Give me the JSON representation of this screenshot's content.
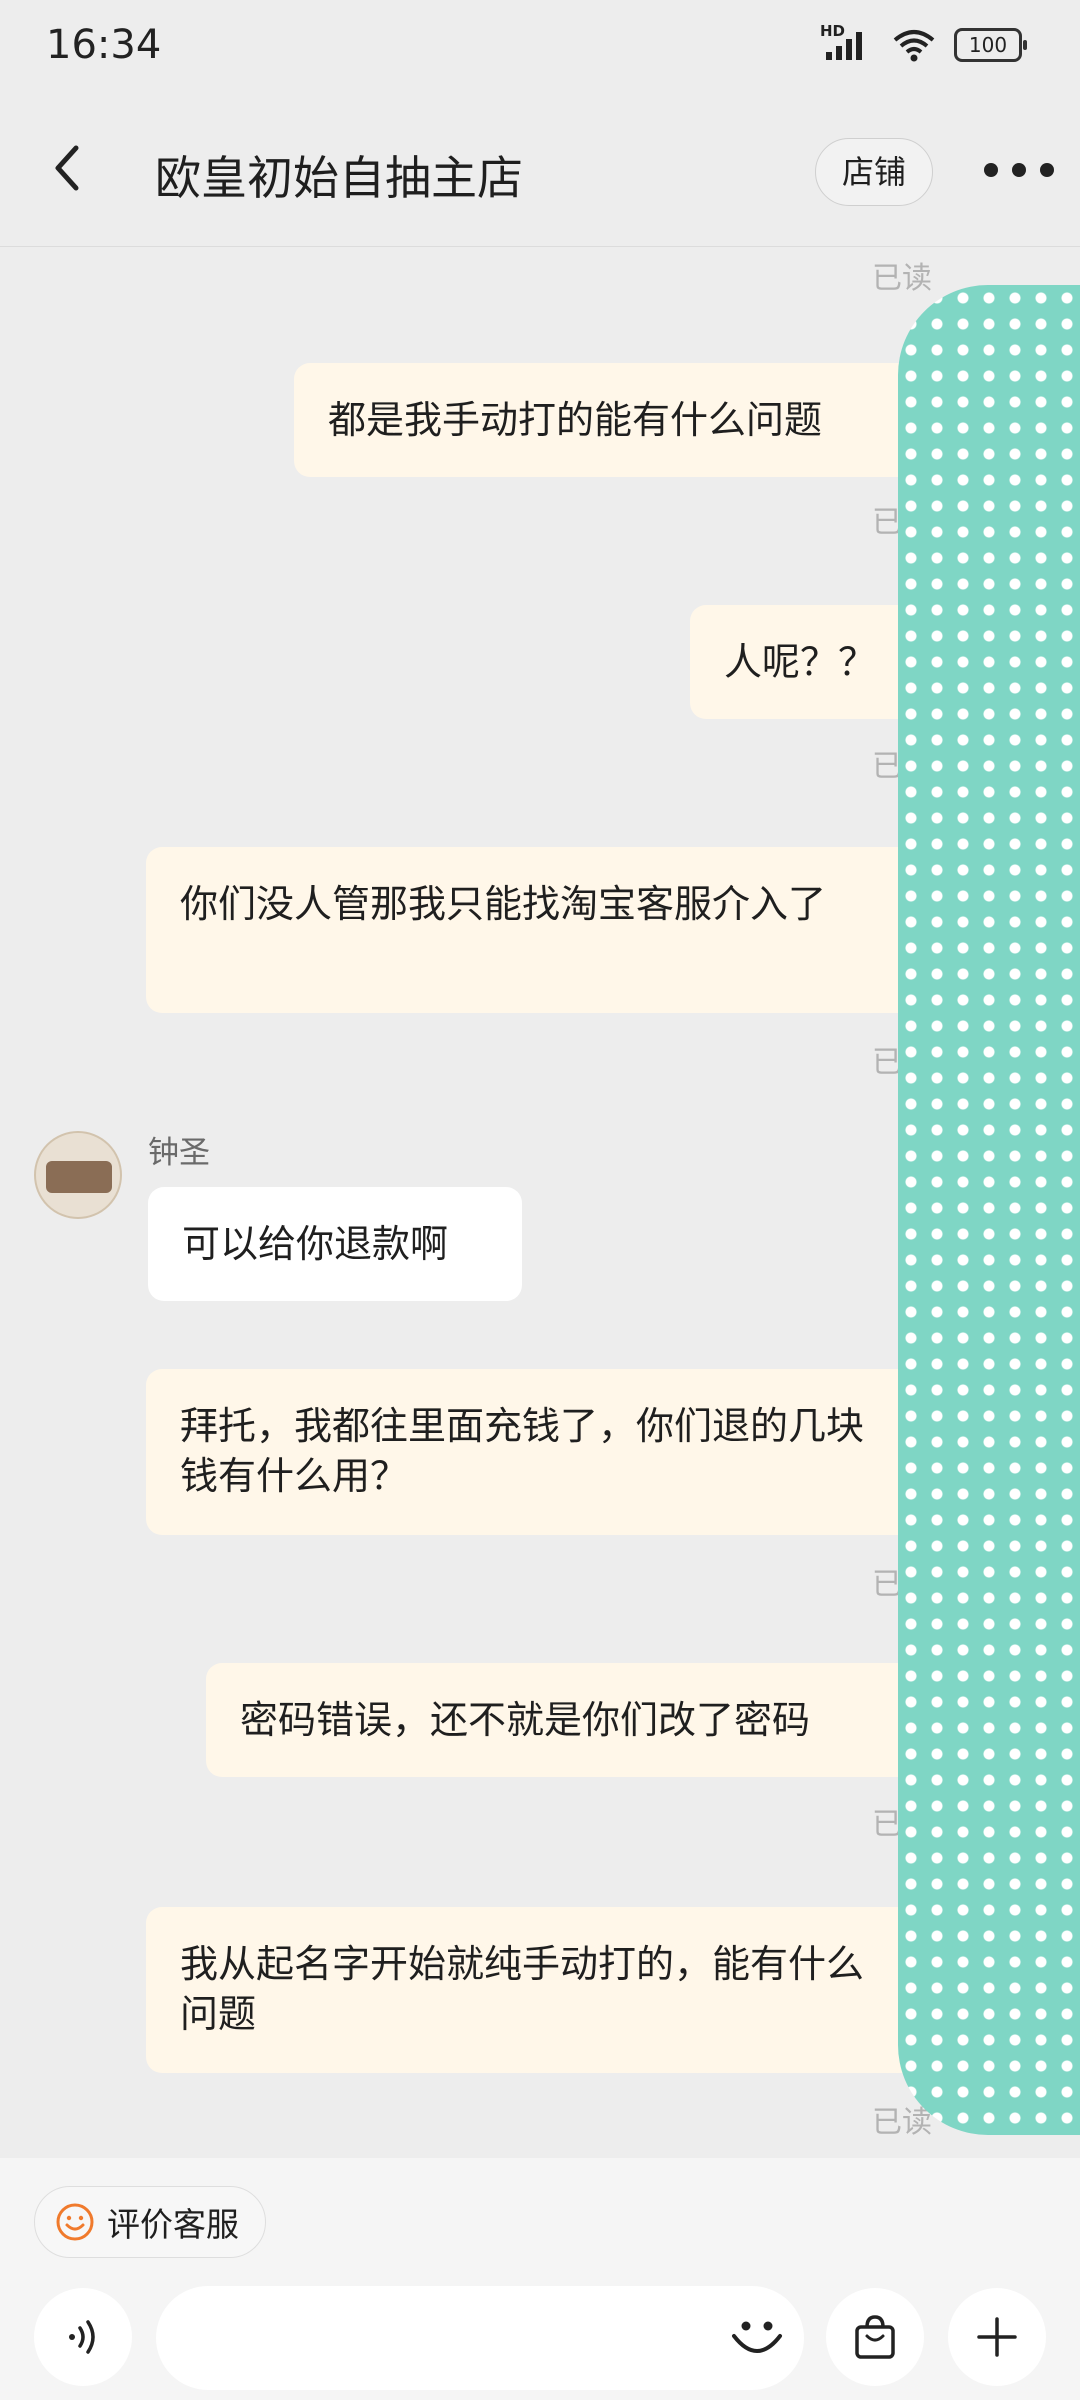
{
  "status_bar": {
    "time": "16:34",
    "network": "HD",
    "battery": "100"
  },
  "header": {
    "title": "欧皇初始自抽主店",
    "shop_button": "店铺"
  },
  "messages": [
    {
      "side": "me",
      "text": "都是我手动打的能有什么问题",
      "read": "已读"
    },
    {
      "side": "me",
      "text": "人呢？？",
      "read": "已读"
    },
    {
      "side": "me",
      "text": "你们没人管那我只能找淘宝客服介入了",
      "read": "已读"
    },
    {
      "side": "them",
      "sender": "钟圣",
      "text": "可以给你退款啊"
    },
    {
      "side": "me",
      "text": "拜托，我都往里面充钱了，你们退的几块钱有什么用？",
      "read": "已读"
    },
    {
      "side": "me",
      "text": "密码错误，还不就是你们改了密码",
      "read": "已读"
    },
    {
      "side": "me",
      "text": "我从起名字开始就纯手动打的，能有什么问题",
      "read": "已读"
    }
  ],
  "top_read": "已读",
  "bottom": {
    "rate_button": "评价客服"
  },
  "colors": {
    "my_bubble": "#fff7e9",
    "their_bubble": "#ffffff",
    "background": "#ededed",
    "overlay": "#7fd6c5"
  },
  "icons": [
    "back-icon",
    "more-icon",
    "smile-icon",
    "voice-icon",
    "emoji-icon",
    "bag-icon",
    "plus-icon"
  ]
}
